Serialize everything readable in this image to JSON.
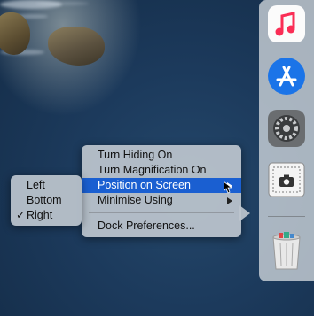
{
  "dock": {
    "apps": [
      {
        "name": "Music",
        "icon": "music-note-icon"
      },
      {
        "name": "App Store",
        "icon": "app-store-icon"
      },
      {
        "name": "System Preferences",
        "icon": "gear-icon"
      },
      {
        "name": "Screenshot",
        "icon": "screenshot-icon"
      },
      {
        "name": "Trash",
        "icon": "trash-icon"
      }
    ]
  },
  "dock_menu": {
    "items": [
      {
        "label": "Turn Hiding On"
      },
      {
        "label": "Turn Magnification On"
      },
      {
        "label": "Position on Screen",
        "selected": true,
        "submenu": true
      },
      {
        "label": "Minimise Using",
        "submenu": true
      },
      {
        "label": "Dock Preferences..."
      }
    ]
  },
  "position_submenu": {
    "items": [
      {
        "label": "Left"
      },
      {
        "label": "Bottom"
      },
      {
        "label": "Right",
        "checked": true
      }
    ],
    "check_mark": "✓"
  },
  "colors": {
    "selection": "#1a5fd1",
    "menu_bg": "#bcc5cd",
    "sea": "#1c3a5c"
  }
}
